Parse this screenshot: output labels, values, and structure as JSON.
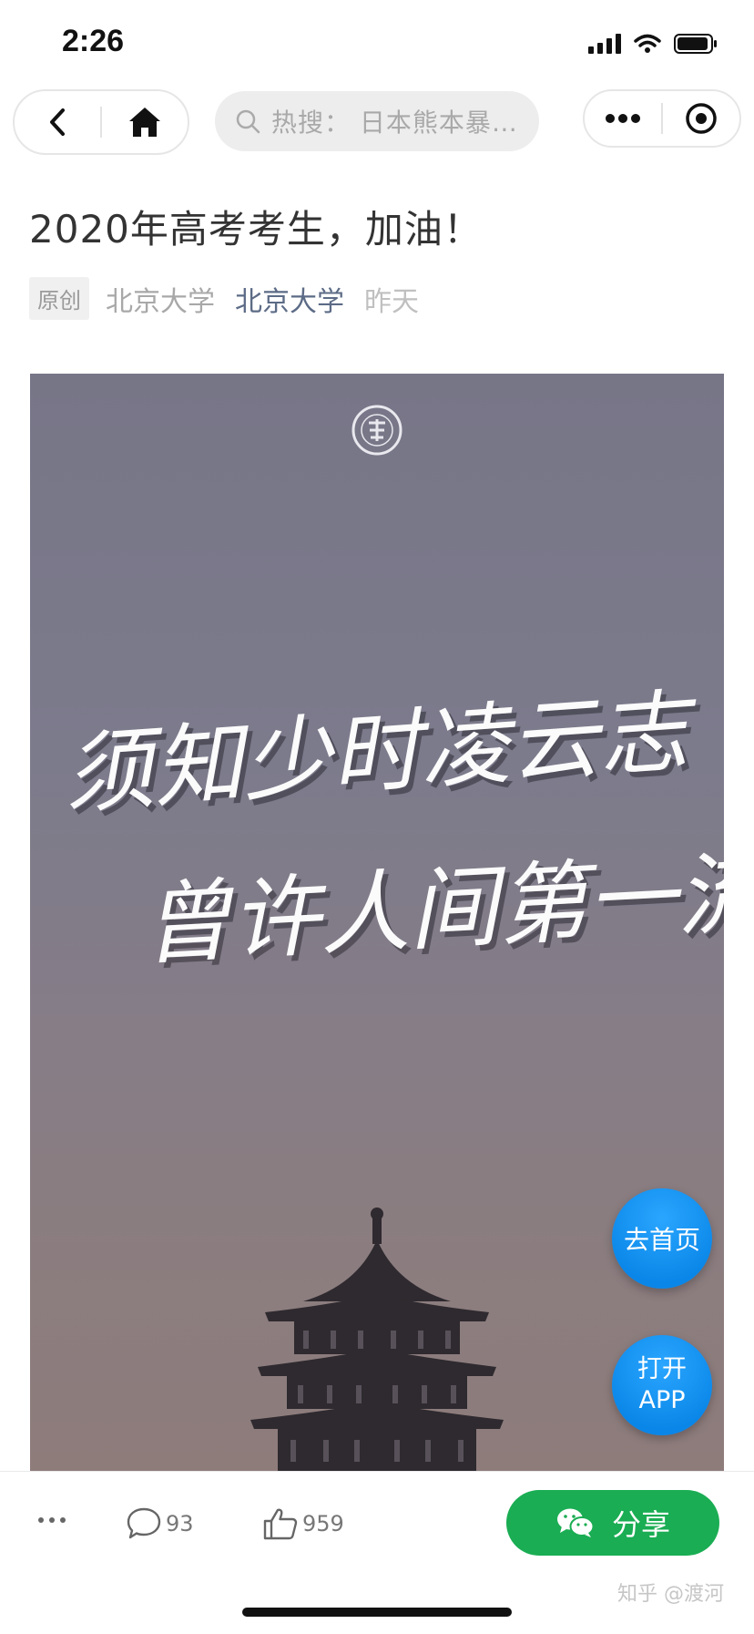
{
  "status_bar": {
    "time": "2:26"
  },
  "nav": {
    "search_hint": "热搜：  日本熊本暴…"
  },
  "article": {
    "title": "2020年高考考生，加油！",
    "tag": "原创",
    "author": "北京大学",
    "account": "北京大学",
    "time": "昨天"
  },
  "poster": {
    "calligraphy_line1": "须知少时凌云志",
    "calligraphy_line2": "曾许人间第一流"
  },
  "floating": {
    "home_label": "去首页",
    "app_line1": "打开",
    "app_line2": "APP"
  },
  "bottom_bar": {
    "comment_count": "93",
    "like_count": "959",
    "share_label": "分享"
  },
  "watermark": "知乎 @渡河",
  "colors": {
    "share_green": "#1aad53",
    "fab_blue": "#0a86e8",
    "account_blue": "#5c6b86"
  }
}
